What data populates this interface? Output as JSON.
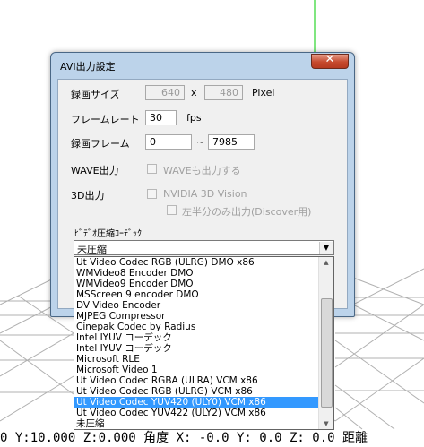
{
  "window": {
    "title": "AVI出力設定",
    "close_label": "✕"
  },
  "form": {
    "size_label": "録画サイズ",
    "width_value": "640",
    "size_separator": "x",
    "height_value": "480",
    "size_unit": "Pixel",
    "framerate_label": "フレームレート",
    "framerate_value": "30",
    "framerate_unit": "fps",
    "frames_label": "録画フレーム",
    "frame_start": "0",
    "frame_separator": "~",
    "frame_end": "7985",
    "wave_label": "WAVE出力",
    "wave_checkbox_label": "WAVEも出力する",
    "wave_checked": false,
    "out3d_label": "3D出力",
    "nvidia_checkbox_label": "NVIDIA 3D Vision",
    "nvidia_checked": false,
    "halfside_checkbox_label": "左半分のみ出力(Discover用)",
    "halfside_checked": false,
    "codec_label": "ﾋﾞﾃﾞｵ圧縮ｺｰﾃﾞｯｸ",
    "codec_selected": "未圧縮"
  },
  "codec_list": [
    "Ut Video Codec RGB (ULRG) DMO x86",
    "WMVideo8 Encoder DMO",
    "WMVideo9 Encoder DMO",
    "MSScreen 9 encoder DMO",
    "DV Video Encoder",
    "MJPEG Compressor",
    "Cinepak Codec by Radius",
    "Intel IYUV コーデック",
    "Intel IYUV コーデック",
    "Microsoft RLE",
    "Microsoft Video 1",
    "Ut Video Codec RGBA (ULRA) VCM x86",
    "Ut Video Codec RGB (ULRG) VCM x86",
    "Ut Video Codec YUV420 (ULY0) VCM x86",
    "Ut Video Codec YUV422 (ULY2) VCM x86",
    "未圧縮"
  ],
  "codec_highlighted_index": 13,
  "status_bar": {
    "text": "0 Y:10.000 Z:0.000  角度 X: -0.0 Y: 0.0 Z: 0.0  距離"
  },
  "colors": {
    "selection": "#3399ff",
    "axis_green": "#00cc00",
    "grid": "#b0b0b0"
  }
}
